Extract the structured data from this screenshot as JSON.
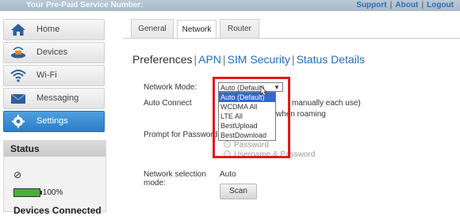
{
  "topbar": {
    "service_number_label": "Your Pre-Paid Service Number:",
    "links": [
      "Support",
      "About",
      "Logout"
    ],
    "bg": "#b3c4d1",
    "link_color": "#2f6fb5"
  },
  "sidebar": {
    "items": [
      {
        "label": "Home",
        "icon": "home-icon"
      },
      {
        "label": "Devices",
        "icon": "devices-icon"
      },
      {
        "label": "Wi-Fi",
        "icon": "wifi-icon"
      },
      {
        "label": "Messaging",
        "icon": "envelope-icon"
      },
      {
        "label": "Settings",
        "icon": "gear-icon",
        "active": true
      }
    ],
    "active_color": "#3a8ad4"
  },
  "status": {
    "title": "Status",
    "no_entry_symbol": "⊘",
    "battery_percent": "100%",
    "devices_connected_label": "Devices Connected"
  },
  "tabs": [
    {
      "label": "General"
    },
    {
      "label": "Network",
      "active": true
    },
    {
      "label": "Router"
    }
  ],
  "pref_nav": {
    "current": "Preferences",
    "links": [
      "APN",
      "SIM Security",
      "Status Details"
    ]
  },
  "form": {
    "network_mode_label": "Network Mode:",
    "network_mode_value": "Auto (Default)",
    "auto_connect_label": "Auto Connect",
    "auto_connect_text_1": "manually each use)",
    "auto_connect_text_2": "when roaming",
    "prompt_password_label": "Prompt for Password",
    "prompt_options": [
      "Password",
      "Username & Password"
    ],
    "network_selection_label_1": "Network selection",
    "network_selection_label_2": "mode:",
    "network_selection_value": "Auto",
    "scan_button": "Scan"
  },
  "dropdown": {
    "options": [
      "Auto (Default)",
      "WCDMA All",
      "LTE All",
      "BestUpload",
      "BestDownload"
    ],
    "selected_index": 0,
    "arrow": "▼"
  },
  "annotation": {
    "highlight_color": "#e2191b"
  }
}
